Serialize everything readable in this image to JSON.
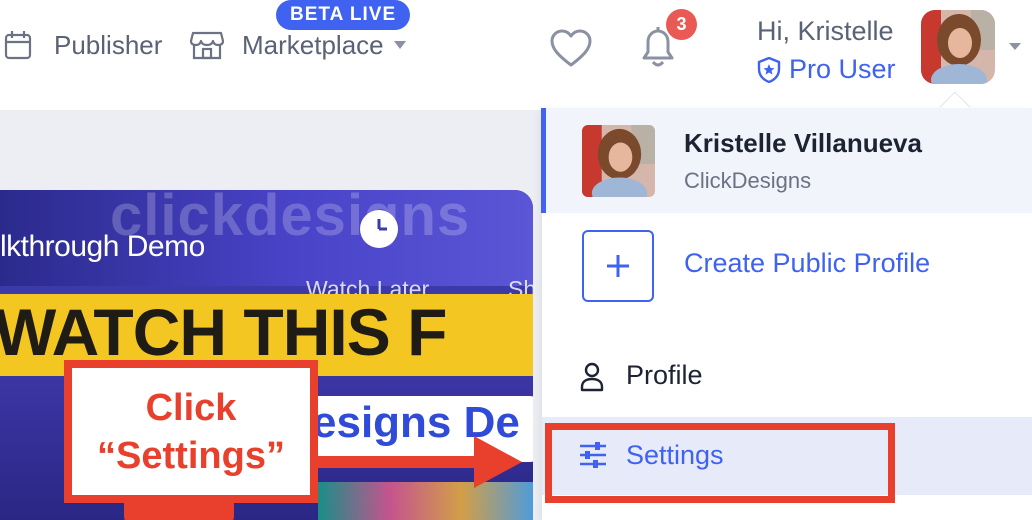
{
  "nav": {
    "publisher_label": "Publisher",
    "marketplace_label": "Marketplace",
    "beta_badge": "BETA LIVE",
    "notification_count": "3"
  },
  "user": {
    "greeting": "Hi, Kristelle",
    "plan": "Pro User",
    "full_name": "Kristelle Villanueva",
    "company": "ClickDesigns"
  },
  "dropdown": {
    "create_profile_label": "Create Public Profile",
    "profile_label": "Profile",
    "settings_label": "Settings"
  },
  "video": {
    "brand_text": "clickdesigns",
    "walkthrough_text": "lkthrough Demo",
    "watch_later": "Watch Later",
    "share_partial": "Sh",
    "headline": "WATCH THIS F",
    "subhead": "esigns De"
  },
  "annotation": {
    "line1": "Click",
    "line2": "“Settings”"
  },
  "colors": {
    "accent": "#3f63f0",
    "annotation_red": "#e8402c",
    "badge_red": "#ea5a55",
    "text_muted": "#5a6275"
  },
  "icons": [
    "calendar-icon",
    "store-icon",
    "heart-icon",
    "bell-icon",
    "shield-icon",
    "plus-icon",
    "person-icon",
    "sliders-icon",
    "clock-icon"
  ]
}
